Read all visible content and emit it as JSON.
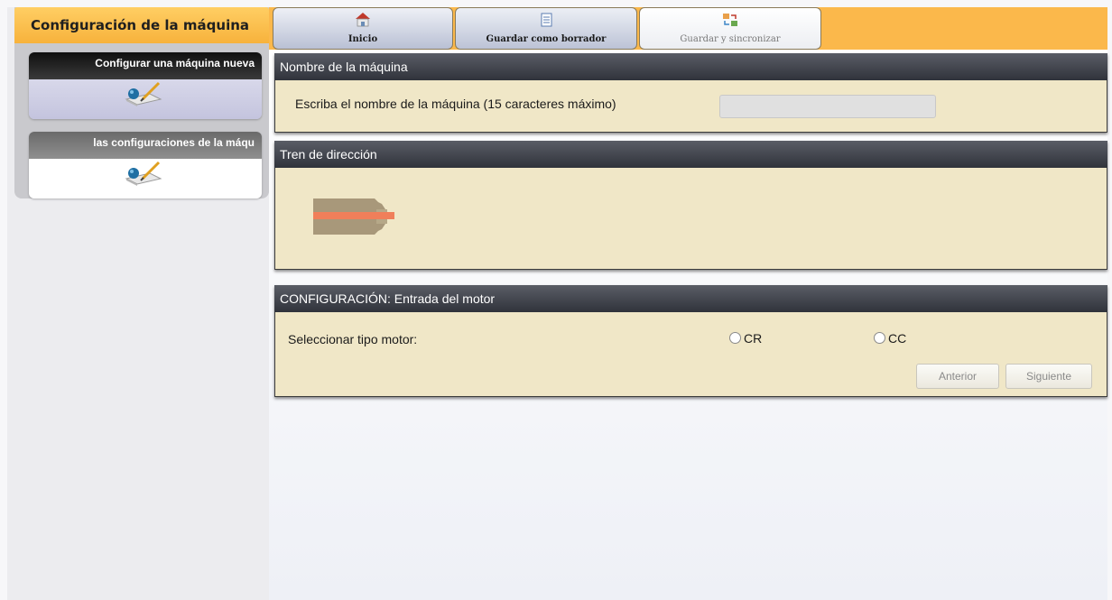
{
  "sidebar": {
    "title": "Configuración de la máquina",
    "cards": [
      {
        "label": "Configurar una máquina nueva",
        "icon": "machine-config-icon"
      },
      {
        "label": "las configuraciones de la máqu",
        "icon": "machine-config-icon"
      }
    ]
  },
  "toolbar": {
    "inicio": {
      "label": "Inicio",
      "icon": "home-icon"
    },
    "guardar_borrador": {
      "label": "Guardar como borrador",
      "icon": "document-icon"
    },
    "guardar_sync": {
      "label": "Guardar y sincronizar",
      "icon": "sync-icon"
    }
  },
  "panels": {
    "nombre": {
      "title": "Nombre de la máquina",
      "field_label": "Escriba el nombre de la máquina (15 caracteres máximo)",
      "input_value": ""
    },
    "tren": {
      "title": "Tren de dirección",
      "graphic": "drive-train-motor-icon"
    },
    "config": {
      "title": "CONFIGURACIÓN: Entrada del motor",
      "motor_label": "Seleccionar tipo motor:",
      "options": [
        "CR",
        "CC"
      ],
      "prev_label": "Anterior",
      "next_label": "Siguiente"
    }
  },
  "colors": {
    "accent_orange": "#fbb84b",
    "panel_body": "#f0e7c7",
    "panel_header": "#3a3d45"
  }
}
